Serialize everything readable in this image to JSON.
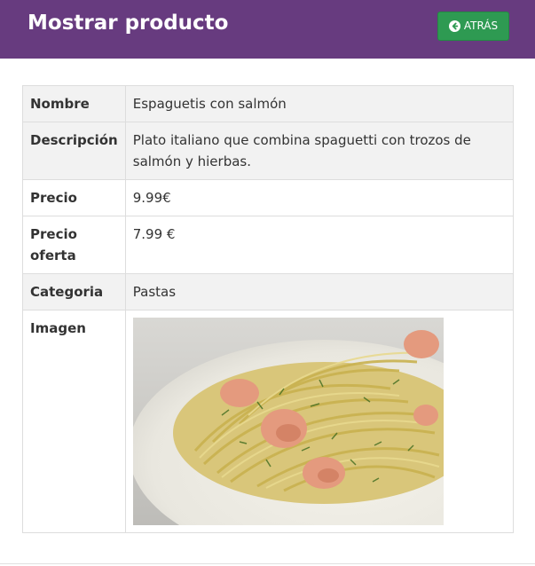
{
  "header": {
    "title": "Mostrar producto",
    "back_label": "ATRÁS",
    "back_icon": "arrow-circle-left-icon",
    "bg_color": "#673b7f",
    "button_color": "#2e9a52"
  },
  "product": {
    "rows": [
      {
        "label": "Nombre",
        "value": "Espaguetis con salmón"
      },
      {
        "label": "Descripción",
        "value": "Plato italiano que combina spaguetti con trozos de salmón y hierbas."
      },
      {
        "label": "Precio",
        "value": "9.99€"
      },
      {
        "label": "Precio oferta",
        "value": "7.99 €"
      },
      {
        "label": "Categoria",
        "value": "Pastas"
      },
      {
        "label": "Imagen"
      }
    ]
  }
}
